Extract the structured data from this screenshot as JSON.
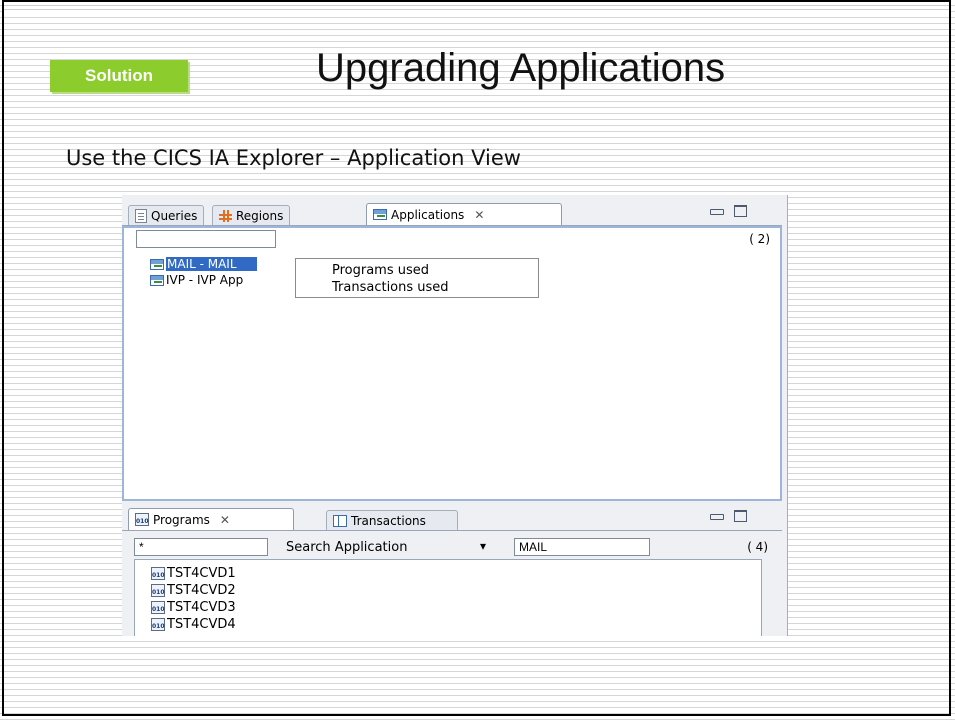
{
  "slide": {
    "badge": "Solution",
    "title": "Upgrading Applications",
    "subtitle": "Use the CICS IA Explorer – Application View"
  },
  "top_view": {
    "tabs": [
      {
        "label": "Queries",
        "icon": "document-icon"
      },
      {
        "label": "Regions",
        "icon": "grid-icon"
      },
      {
        "label": "Applications",
        "icon": "application-icon",
        "active": true
      }
    ],
    "filter_value": "",
    "count": "( 2)",
    "tree_items": [
      {
        "label": "MAIL - MAIL",
        "selected": true
      },
      {
        "label": "IVP - IVP App"
      }
    ],
    "context_menu": [
      "Programs used",
      "Transactions used"
    ]
  },
  "bottom_view": {
    "tabs": [
      {
        "label": "Programs",
        "icon": "program-icon",
        "active": true
      },
      {
        "label": "Transactions",
        "icon": "table-icon"
      }
    ],
    "filter_value": "*",
    "search_label": "Search Application",
    "search_value": "MAIL",
    "count": "( 4)",
    "programs": [
      "TST4CVD1",
      "TST4CVD2",
      "TST4CVD3",
      "TST4CVD4"
    ]
  },
  "colors": {
    "badge": "#8ccc2d",
    "selection": "#316ac5",
    "panel_border": "#9db5d8"
  }
}
